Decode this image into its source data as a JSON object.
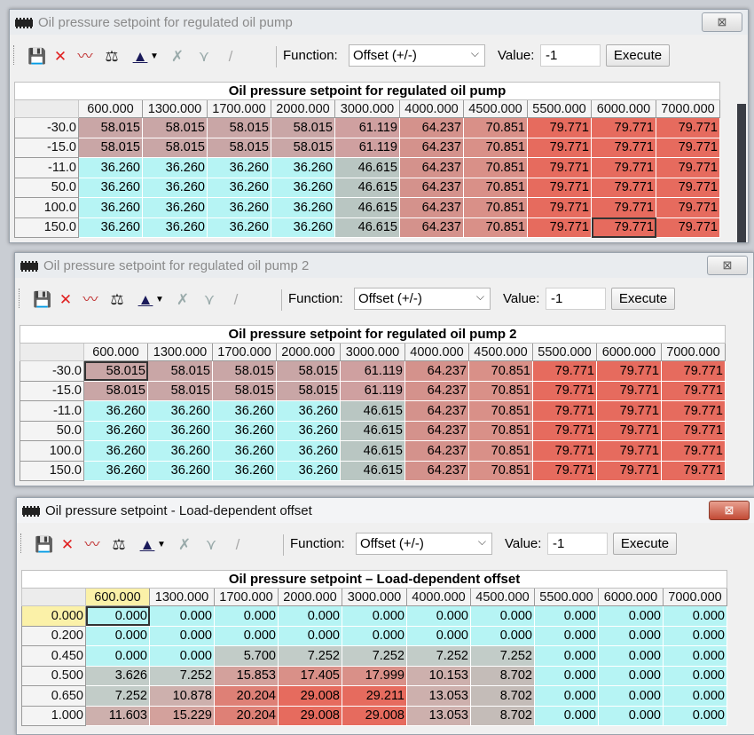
{
  "toolbar": {
    "icons": [
      "save-icon",
      "delete-icon",
      "graph-icon",
      "balance-icon",
      "fill-icon",
      "clear-icon",
      "interpolate-icon",
      "smooth-icon"
    ],
    "function_label": "Function:",
    "function_value": "Offset (+/-)",
    "value_label": "Value:",
    "value_value": "-1",
    "execute_label": "Execute"
  },
  "close_glyph": "⊠",
  "windows": [
    {
      "title": "Oil pressure setpoint for regulated oil pump",
      "grid_title": "Oil pressure setpoint for regulated oil pump",
      "columns": [
        "600.000",
        "1300.000",
        "1700.000",
        "2000.000",
        "3000.000",
        "4000.000",
        "4500.000",
        "5500.000",
        "6000.000",
        "7000.000"
      ],
      "rows": [
        {
          "label": "-30.0",
          "values": [
            "58.015",
            "58.015",
            "58.015",
            "58.015",
            "61.119",
            "64.237",
            "70.851",
            "79.771",
            "79.771",
            "79.771"
          ]
        },
        {
          "label": "-15.0",
          "values": [
            "58.015",
            "58.015",
            "58.015",
            "58.015",
            "61.119",
            "64.237",
            "70.851",
            "79.771",
            "79.771",
            "79.771"
          ]
        },
        {
          "label": "-11.0",
          "values": [
            "36.260",
            "36.260",
            "36.260",
            "36.260",
            "46.615",
            "64.237",
            "70.851",
            "79.771",
            "79.771",
            "79.771"
          ]
        },
        {
          "label": "50.0",
          "values": [
            "36.260",
            "36.260",
            "36.260",
            "36.260",
            "46.615",
            "64.237",
            "70.851",
            "79.771",
            "79.771",
            "79.771"
          ]
        },
        {
          "label": "100.0",
          "values": [
            "36.260",
            "36.260",
            "36.260",
            "36.260",
            "46.615",
            "64.237",
            "70.851",
            "79.771",
            "79.771",
            "79.771"
          ]
        },
        {
          "label": "150.0",
          "values": [
            "36.260",
            "36.260",
            "36.260",
            "36.260",
            "46.615",
            "64.237",
            "70.851",
            "79.771",
            "79.771",
            "79.771"
          ]
        }
      ]
    },
    {
      "title": "Oil pressure setpoint for regulated oil pump 2",
      "grid_title": "Oil pressure setpoint for regulated oil pump 2",
      "columns": [
        "600.000",
        "1300.000",
        "1700.000",
        "2000.000",
        "3000.000",
        "4000.000",
        "4500.000",
        "5500.000",
        "6000.000",
        "7000.000"
      ],
      "rows": [
        {
          "label": "-30.0",
          "values": [
            "58.015",
            "58.015",
            "58.015",
            "58.015",
            "61.119",
            "64.237",
            "70.851",
            "79.771",
            "79.771",
            "79.771"
          ]
        },
        {
          "label": "-15.0",
          "values": [
            "58.015",
            "58.015",
            "58.015",
            "58.015",
            "61.119",
            "64.237",
            "70.851",
            "79.771",
            "79.771",
            "79.771"
          ]
        },
        {
          "label": "-11.0",
          "values": [
            "36.260",
            "36.260",
            "36.260",
            "36.260",
            "46.615",
            "64.237",
            "70.851",
            "79.771",
            "79.771",
            "79.771"
          ]
        },
        {
          "label": "50.0",
          "values": [
            "36.260",
            "36.260",
            "36.260",
            "36.260",
            "46.615",
            "64.237",
            "70.851",
            "79.771",
            "79.771",
            "79.771"
          ]
        },
        {
          "label": "100.0",
          "values": [
            "36.260",
            "36.260",
            "36.260",
            "36.260",
            "46.615",
            "64.237",
            "70.851",
            "79.771",
            "79.771",
            "79.771"
          ]
        },
        {
          "label": "150.0",
          "values": [
            "36.260",
            "36.260",
            "36.260",
            "36.260",
            "46.615",
            "64.237",
            "70.851",
            "79.771",
            "79.771",
            "79.771"
          ]
        }
      ]
    },
    {
      "title": "Oil pressure setpoint - Load-dependent offset",
      "grid_title": "Oil pressure setpoint – Load-dependent offset",
      "columns": [
        "600.000",
        "1300.000",
        "1700.000",
        "2000.000",
        "3000.000",
        "4000.000",
        "4500.000",
        "5500.000",
        "6000.000",
        "7000.000"
      ],
      "rows": [
        {
          "label": "0.000",
          "values": [
            "0.000",
            "0.000",
            "0.000",
            "0.000",
            "0.000",
            "0.000",
            "0.000",
            "0.000",
            "0.000",
            "0.000"
          ]
        },
        {
          "label": "0.200",
          "values": [
            "0.000",
            "0.000",
            "0.000",
            "0.000",
            "0.000",
            "0.000",
            "0.000",
            "0.000",
            "0.000",
            "0.000"
          ]
        },
        {
          "label": "0.450",
          "values": [
            "0.000",
            "0.000",
            "5.700",
            "7.252",
            "7.252",
            "7.252",
            "7.252",
            "0.000",
            "0.000",
            "0.000"
          ]
        },
        {
          "label": "0.500",
          "values": [
            "3.626",
            "7.252",
            "15.853",
            "17.405",
            "17.999",
            "10.153",
            "8.702",
            "0.000",
            "0.000",
            "0.000"
          ]
        },
        {
          "label": "0.650",
          "values": [
            "7.252",
            "10.878",
            "20.204",
            "29.008",
            "29.211",
            "13.053",
            "8.702",
            "0.000",
            "0.000",
            "0.000"
          ]
        },
        {
          "label": "1.000",
          "values": [
            "11.603",
            "15.229",
            "20.204",
            "29.008",
            "29.008",
            "13.053",
            "8.702",
            "0.000",
            "0.000",
            "0.000"
          ]
        }
      ]
    }
  ],
  "colors": {
    "low": "#b6f4f4",
    "mid_grey": "#b9c6c2",
    "mid_rose": "#c9a6a6",
    "high_rose": "#d99088",
    "high_red": "#e66b5e",
    "max_red": "#ee5a50"
  }
}
